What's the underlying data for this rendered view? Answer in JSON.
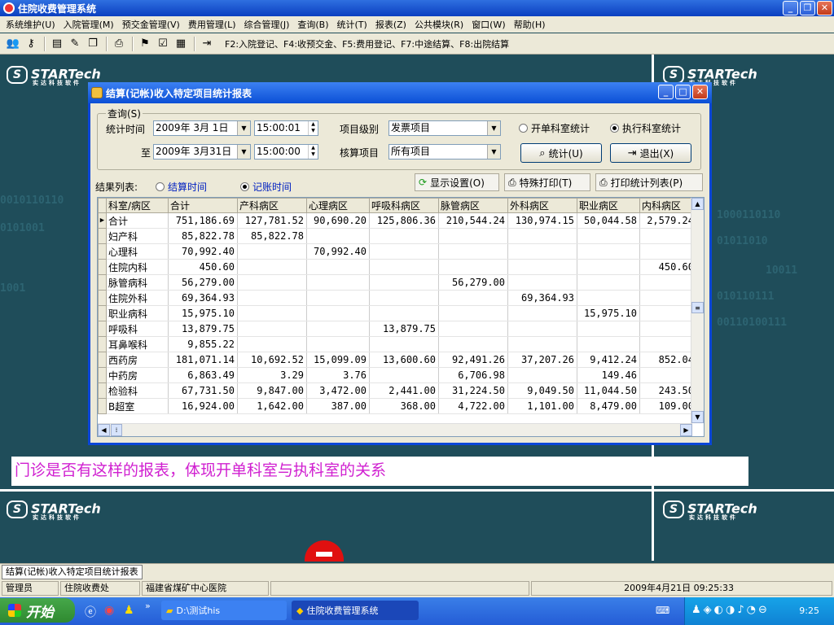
{
  "app": {
    "title": "住院收费管理系统"
  },
  "menu": [
    "系统维护(U)",
    "入院管理(M)",
    "预交金管理(V)",
    "费用管理(L)",
    "综合管理(J)",
    "查询(B)",
    "统计(T)",
    "报表(Z)",
    "公共模块(R)",
    "窗口(W)",
    "帮助(H)"
  ],
  "toolbar": {
    "hotkeys": "F2:入院登记、F4:收预交金、F5:费用登记、F7:中途结算、F8:出院结算"
  },
  "desktop": {
    "logo_text": "STARTech",
    "logo_sub": "实达科技软件",
    "digits": [
      "0010110110",
      "0101001",
      "1001",
      "1000110110",
      "01011010",
      "10011",
      "010110111",
      "00110100111"
    ],
    "note": "门诊是否有这样的报表，体现开单科室与执科室的关系"
  },
  "dialog": {
    "title": "结算(记帐)收入特定项目统计报表",
    "group_label": "查询(S)",
    "stat_time_label": "统计时间",
    "date_from": "2009年 3月 1日",
    "time_from": "15:00:01",
    "to_label": "至",
    "date_to": "2009年 3月31日",
    "time_to": "15:00:00",
    "item_level_label": "项目级别",
    "item_level_value": "发票项目",
    "audit_item_label": "核算项目",
    "audit_item_value": "所有项目",
    "radio_order_dept": "开单科室统计",
    "radio_exec_dept": "执行科室统计",
    "btn_stat": "统计(U)",
    "btn_exit": "退出(X)",
    "result_label": "结果列表:",
    "radio_settle_time": "结算时间",
    "radio_bill_time": "记账时间",
    "btn_display": "显示设置(O)",
    "btn_special_print": "特殊打印(T)",
    "btn_print_list": "打印统计列表(P)"
  },
  "table": {
    "columns": [
      "科室/病区",
      "合计",
      "产科病区",
      "心理病区",
      "呼吸科病区",
      "脉管病区",
      "外科病区",
      "职业病区",
      "内科病区"
    ],
    "rows": [
      [
        "合计",
        "751,186.69",
        "127,781.52",
        "90,690.20",
        "125,806.36",
        "210,544.24",
        "130,974.15",
        "50,044.58",
        "2,579.24"
      ],
      [
        "妇产科",
        "85,822.78",
        "85,822.78",
        "",
        "",
        "",
        "",
        "",
        ""
      ],
      [
        "心理科",
        "70,992.40",
        "",
        "70,992.40",
        "",
        "",
        "",
        "",
        ""
      ],
      [
        "住院内科",
        "450.60",
        "",
        "",
        "",
        "",
        "",
        "",
        "450.60"
      ],
      [
        "脉管病科",
        "56,279.00",
        "",
        "",
        "",
        "56,279.00",
        "",
        "",
        ""
      ],
      [
        "住院外科",
        "69,364.93",
        "",
        "",
        "",
        "",
        "69,364.93",
        "",
        ""
      ],
      [
        "职业病科",
        "15,975.10",
        "",
        "",
        "",
        "",
        "",
        "15,975.10",
        ""
      ],
      [
        "呼吸科",
        "13,879.75",
        "",
        "",
        "13,879.75",
        "",
        "",
        "",
        ""
      ],
      [
        "耳鼻喉科",
        "9,855.22",
        "",
        "",
        "",
        "",
        "",
        "",
        ""
      ],
      [
        "西药房",
        "181,071.14",
        "10,692.52",
        "15,099.09",
        "13,600.60",
        "92,491.26",
        "37,207.26",
        "9,412.24",
        "852.04"
      ],
      [
        "中药房",
        "6,863.49",
        "3.29",
        "3.76",
        "",
        "6,706.98",
        "",
        "149.46",
        ""
      ],
      [
        "检验科",
        "67,731.50",
        "9,847.00",
        "3,472.00",
        "2,441.00",
        "31,224.50",
        "9,049.50",
        "11,044.50",
        "243.50"
      ],
      [
        "B超室",
        "16,924.00",
        "1,642.00",
        "387.00",
        "368.00",
        "4,722.00",
        "1,101.00",
        "8,479.00",
        "109.00"
      ]
    ]
  },
  "status": {
    "tab": "结算(记帐)收入特定项目统计报表",
    "user": "管理员",
    "office": "住院收费处",
    "hospital": "福建省煤矿中心医院",
    "datetime": "2009年4月21日 09:25:33"
  },
  "taskbar": {
    "start": "开始",
    "task1": "D:\\测试his",
    "task2": "住院收费管理系统",
    "clock": "9:25"
  }
}
